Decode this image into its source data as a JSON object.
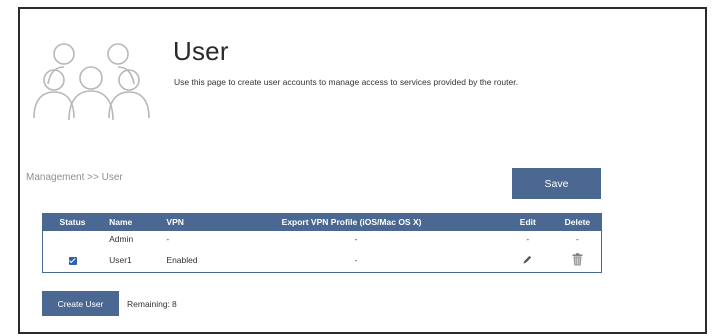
{
  "header": {
    "title": "User",
    "description": "Use this page to create user accounts to manage access to services provided by the router.",
    "icon": "users-group-icon"
  },
  "breadcrumb": "Management >> User",
  "toolbar": {
    "save_label": "Save"
  },
  "colors": {
    "accent": "#4a6891",
    "checkbox": "#2f5fb3"
  },
  "table": {
    "headers": {
      "status": "Status",
      "name": "Name",
      "vpn": "VPN",
      "export": "Export VPN Profile (iOS/Mac OS X)",
      "edit": "Edit",
      "delete": "Delete"
    },
    "rows": [
      {
        "status": "",
        "name": "Admin",
        "vpn": "-",
        "export": "-",
        "edit": "-",
        "delete": "-"
      },
      {
        "status_checked": true,
        "name": "User1",
        "vpn": "Enabled",
        "export": "-",
        "edit_icon": "pencil-icon",
        "delete_icon": "trash-icon"
      }
    ]
  },
  "footer": {
    "create_label": "Create User",
    "remaining_label": "Remaining:",
    "remaining_value": "8"
  }
}
